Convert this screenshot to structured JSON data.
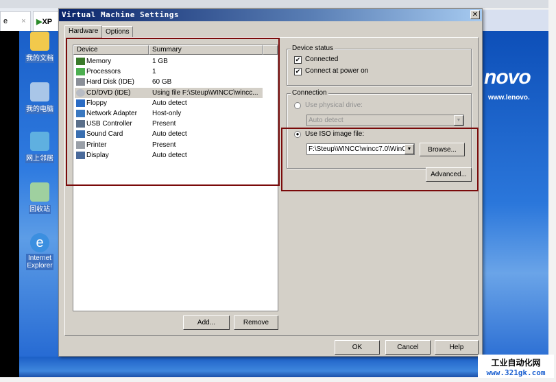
{
  "browser": {
    "tab1_label": "e",
    "tab1_close": "×",
    "tab2_label": "XP"
  },
  "desktop": {
    "icons": [
      {
        "label": "我的文档"
      },
      {
        "label": "我的电脑"
      },
      {
        "label": "网上邻居"
      },
      {
        "label": "回收站"
      },
      {
        "label": "Internet Explorer"
      }
    ],
    "brand": "novo",
    "brand_url": "www.lenovo."
  },
  "dialog": {
    "title": "Virtual Machine Settings",
    "close": "✕",
    "tabs": [
      {
        "label": "Hardware",
        "active": true
      },
      {
        "label": "Options",
        "active": false
      }
    ],
    "list": {
      "headers": [
        "Device",
        "Summary"
      ],
      "rows": [
        {
          "device": "Memory",
          "summary": "1 GB",
          "icon": "memory-icon"
        },
        {
          "device": "Processors",
          "summary": "1",
          "icon": "processor-icon"
        },
        {
          "device": "Hard Disk (IDE)",
          "summary": "60 GB",
          "icon": "hard-disk-icon"
        },
        {
          "device": "CD/DVD (IDE)",
          "summary": "Using file F:\\Steup\\WINCC\\wincc...",
          "icon": "cd-icon",
          "selected": true
        },
        {
          "device": "Floppy",
          "summary": "Auto detect",
          "icon": "floppy-icon"
        },
        {
          "device": "Network Adapter",
          "summary": "Host-only",
          "icon": "network-icon"
        },
        {
          "device": "USB Controller",
          "summary": "Present",
          "icon": "usb-icon"
        },
        {
          "device": "Sound Card",
          "summary": "Auto detect",
          "icon": "sound-icon"
        },
        {
          "device": "Printer",
          "summary": "Present",
          "icon": "printer-icon"
        },
        {
          "device": "Display",
          "summary": "Auto detect",
          "icon": "display-icon"
        }
      ]
    },
    "add": "Add...",
    "remove": "Remove",
    "device_status": {
      "title": "Device status",
      "connected": "Connected",
      "connect_power": "Connect at power on",
      "connected_checked": true,
      "power_checked": true
    },
    "connection": {
      "title": "Connection",
      "physical": "Use physical drive:",
      "physical_value": "Auto detect",
      "iso": "Use ISO image file:",
      "iso_value": "F:\\Steup\\WINCC\\wincc7.0\\WinC",
      "browse": "Browse...",
      "selected": "iso"
    },
    "advanced": "Advanced...",
    "ok": "OK",
    "cancel": "Cancel",
    "help": "Help"
  },
  "watermark": {
    "line1": "工业自动化网",
    "line2": "www.321gk.com"
  },
  "colors": {
    "highlight": "#7a0a0a",
    "dialog_bg": "#d4d0c8",
    "title_start": "#0a246a"
  }
}
